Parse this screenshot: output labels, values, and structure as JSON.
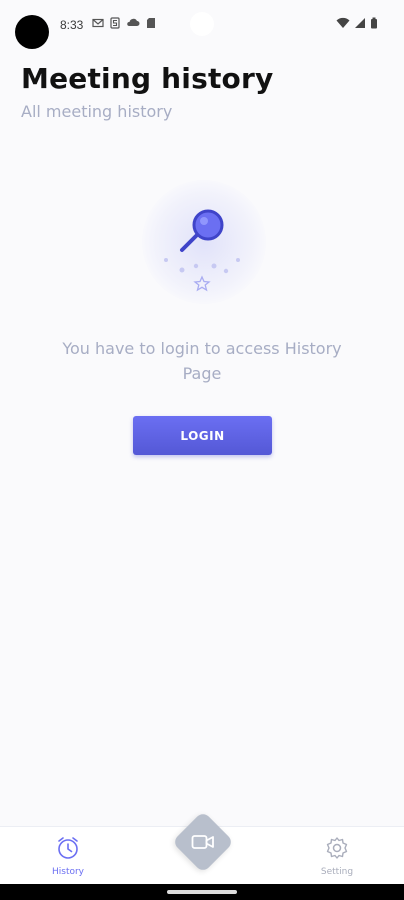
{
  "status_bar": {
    "time": "8:33",
    "left_icons": [
      "mail-icon",
      "s-icon",
      "cloud-icon",
      "sdcard-icon"
    ],
    "right_icons": [
      "wifi-icon",
      "signal-icon",
      "battery-icon"
    ]
  },
  "header": {
    "title": "Meeting history",
    "subtitle": "All meeting history"
  },
  "empty_state": {
    "illustration": "magnifier-icon",
    "message": "You have to login to access History Page",
    "login_label": "LOGIN"
  },
  "bottom_nav": {
    "history_label": "History",
    "setting_label": "Setting",
    "fab_icon": "video-camera-icon"
  },
  "colors": {
    "accent": "#6b6ff2",
    "muted_text": "#a7adc4",
    "fab": "#b8bfcc"
  }
}
